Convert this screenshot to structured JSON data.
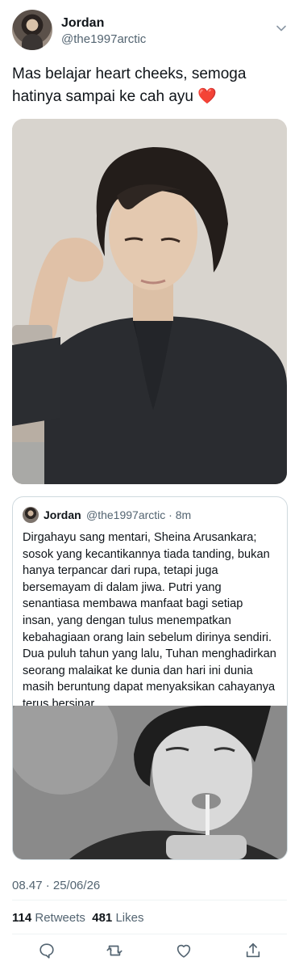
{
  "author": {
    "display_name": "Jordan",
    "handle": "@the1997arctic"
  },
  "tweet": {
    "text": "Mas belajar heart cheeks, semoga hatinya sampai ke cah ayu",
    "emoji": "❤️"
  },
  "quoted_tweet": {
    "display_name": "Jordan",
    "handle_time": "@the1997arctic · 8m",
    "text": "Dirgahayu sang mentari, Sheina Arusankara; sosok yang kecantikannya tiada tanding, bukan hanya terpancar dari rupa, tetapi juga bersemayam di dalam jiwa. Putri yang senantiasa membawa manfaat bagi setiap insan, yang dengan tulus menempatkan kebahagiaan orang lain sebelum dirinya sendiri. Dua puluh tahun yang lalu, Tuhan menghadirkan seorang malaikat ke dunia dan hari ini dunia masih beruntung dapat menyaksikan cahayanya terus bersinar"
  },
  "timestamp": "08.47 · 25/06/26",
  "stats": {
    "retweets_count": "114",
    "retweets_label": "Retweets",
    "likes_count": "481",
    "likes_label": "Likes"
  },
  "icons": {
    "menu": "chevron-down-icon",
    "reply": "reply-icon",
    "retweet": "retweet-icon",
    "like": "heart-icon",
    "share": "share-icon"
  },
  "colors": {
    "text": "#0f1419",
    "muted": "#536471",
    "heart": "#e0245e",
    "border": "#cfd9de"
  }
}
